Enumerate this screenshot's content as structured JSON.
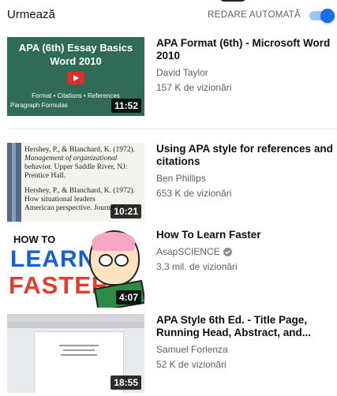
{
  "header": {
    "title": "Urmează",
    "autoplay_label": "REDARE AUTOMATĂ",
    "autoplay_on": true,
    "accent_color": "#1a6fe8"
  },
  "videos": [
    {
      "title": "APA Format (6th) - Microsoft Word 2010",
      "channel": "David Taylor",
      "views": "157 K de vizionări",
      "duration": "11:52",
      "thumb_text": {
        "line1": "APA (6th) Essay Basics",
        "line2": "Word 2010",
        "line3": "Format • Citations • References",
        "line4": "Paragraph Formulas"
      }
    },
    {
      "title": "Using APA style for references and citations",
      "channel": "Ben Phillips",
      "views": "653 K de vizionări",
      "duration": "10:21",
      "thumb_text": {
        "line1": "Hershey, P., & Blanchard, K. (1972).",
        "line2": "Management of organizational",
        "line3": "behavior. Upper Saddle River, NJ:",
        "line4": "Prentice Hall.",
        "line5": "Hershey, P., & Blanchard, K. (1972).",
        "line6": "How situational leaders",
        "line7": "American perspective. Journal of"
      }
    },
    {
      "title": "How To Learn Faster",
      "channel": "AsapSCIENCE",
      "verified": true,
      "views": "3,3 mil. de vizionări",
      "duration": "4:07",
      "thumb_text": {
        "how": "HOW TO",
        "learn": "LEARN",
        "faster": "FASTER"
      }
    },
    {
      "title": "APA Style 6th Ed. - Title Page, Running Head, Abstract, and...",
      "channel": "Samuel Forlenza",
      "views": "52 K de vizionări",
      "duration": "18:55"
    }
  ]
}
